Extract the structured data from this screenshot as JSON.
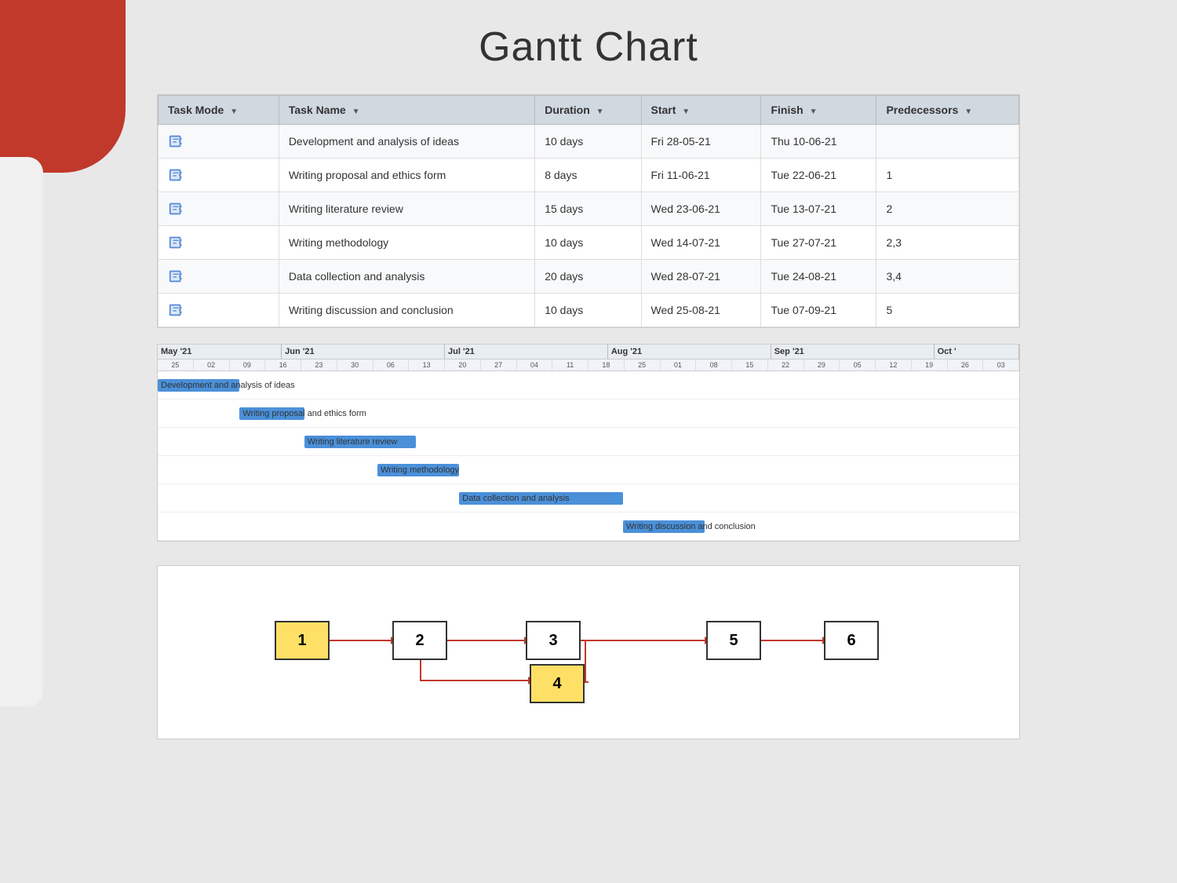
{
  "page": {
    "title": "Gantt Chart",
    "background": {
      "accent_color": "#c0392b"
    }
  },
  "table": {
    "headers": [
      "Task Mode",
      "Task Name",
      "Duration",
      "Start",
      "Finish",
      "Predecessors"
    ],
    "rows": [
      {
        "mode": "auto",
        "name": "Development and analysis of ideas",
        "duration": "10 days",
        "start": "Fri 28-05-21",
        "finish": "Thu 10-06-21",
        "predecessors": ""
      },
      {
        "mode": "auto",
        "name": "Writing proposal and ethics form",
        "duration": "8 days",
        "start": "Fri 11-06-21",
        "finish": "Tue 22-06-21",
        "predecessors": "1"
      },
      {
        "mode": "auto",
        "name": "Writing literature review",
        "duration": "15 days",
        "start": "Wed 23-06-21",
        "finish": "Tue 13-07-21",
        "predecessors": "2"
      },
      {
        "mode": "auto",
        "name": "Writing methodology",
        "duration": "10 days",
        "start": "Wed 14-07-21",
        "finish": "Tue 27-07-21",
        "predecessors": "2,3"
      },
      {
        "mode": "auto",
        "name": "Data collection and analysis",
        "duration": "20 days",
        "start": "Wed 28-07-21",
        "finish": "Tue 24-08-21",
        "predecessors": "3,4"
      },
      {
        "mode": "auto",
        "name": "Writing discussion and conclusion",
        "duration": "10 days",
        "start": "Wed 25-08-21",
        "finish": "Tue 07-09-21",
        "predecessors": "5"
      }
    ]
  },
  "gantt": {
    "months": [
      "May '21",
      "Jun '21",
      "Jul '21",
      "Aug '21",
      "Sep '21",
      "Oct '"
    ],
    "dates": [
      "25",
      "02",
      "09",
      "16",
      "23",
      "30",
      "06",
      "13",
      "20",
      "27",
      "04",
      "11",
      "18",
      "25",
      "01",
      "08",
      "15",
      "22",
      "29",
      "05",
      "12",
      "19",
      "26",
      "03"
    ],
    "tasks": [
      {
        "label": "Development and analysis of ideas",
        "bar_start_pct": 0,
        "bar_width_pct": 9.5
      },
      {
        "label": "Writing proposal and ethics form",
        "bar_start_pct": 9.5,
        "bar_width_pct": 8
      },
      {
        "label": "Writing literature review",
        "bar_start_pct": 18,
        "bar_width_pct": 14
      },
      {
        "label": "Writing methodology",
        "bar_start_pct": 27,
        "bar_width_pct": 9.5
      },
      {
        "label": "Data collection and analysis",
        "bar_start_pct": 37,
        "bar_width_pct": 19
      },
      {
        "label": "Writing discussion and conclusion",
        "bar_start_pct": 56.5,
        "bar_width_pct": 9.5
      }
    ]
  },
  "network": {
    "nodes": [
      {
        "id": "1",
        "label": "1"
      },
      {
        "id": "2",
        "label": "2"
      },
      {
        "id": "3",
        "label": "3"
      },
      {
        "id": "4",
        "label": "4"
      },
      {
        "id": "5",
        "label": "5"
      },
      {
        "id": "6",
        "label": "6"
      }
    ]
  }
}
